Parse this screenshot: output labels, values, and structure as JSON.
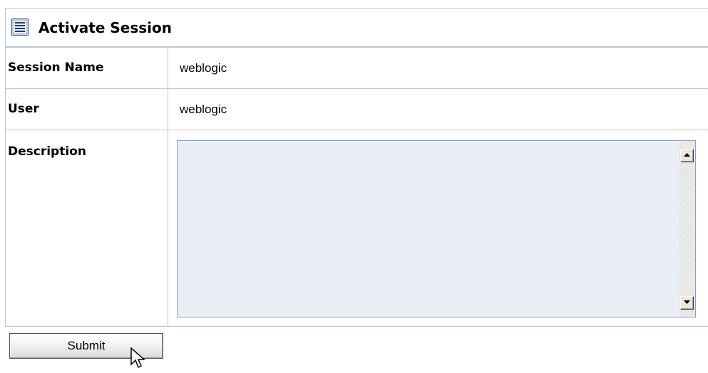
{
  "panel": {
    "title": "Activate Session",
    "icon": "list-document-icon"
  },
  "form": {
    "rows": [
      {
        "label": "Session Name",
        "value": "weblogic"
      },
      {
        "label": "User",
        "value": "weblogic"
      },
      {
        "label": "Description",
        "value": ""
      }
    ]
  },
  "actions": {
    "submit_label": "Submit"
  },
  "cursor": {
    "icon": "mouse-pointer-icon"
  },
  "colors": {
    "border": "#b9c6d4",
    "textarea_bg": "#e9eff5",
    "textarea_border": "#7ea3c4"
  }
}
